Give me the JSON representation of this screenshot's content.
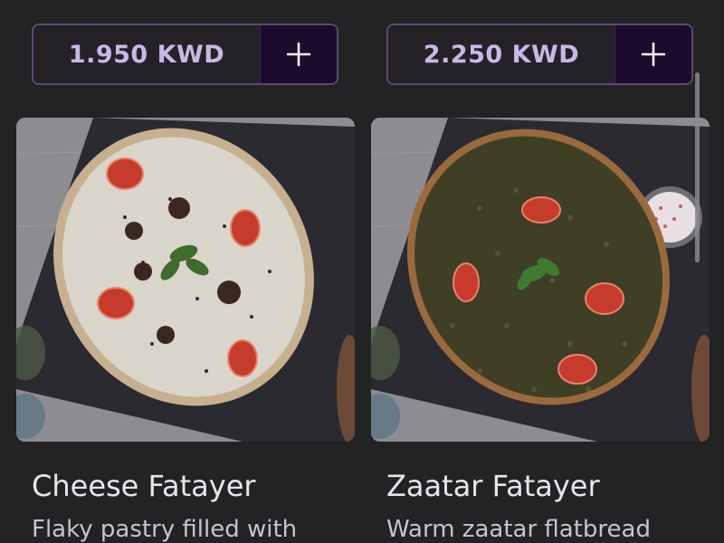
{
  "products": [
    {
      "price": "1.950 KWD",
      "add_icon": "plus-icon",
      "name": "Cheese Fatayer",
      "description": "Flaky pastry filled with"
    },
    {
      "price": "2.250 KWD",
      "add_icon": "plus-icon",
      "name": "Zaatar Fatayer",
      "description": "Warm zaatar flatbread"
    }
  ],
  "colors": {
    "background": "#232224",
    "accent_border": "#5b4a73",
    "add_button": "#1d0b2e",
    "price_text": "#c9b8e6"
  }
}
